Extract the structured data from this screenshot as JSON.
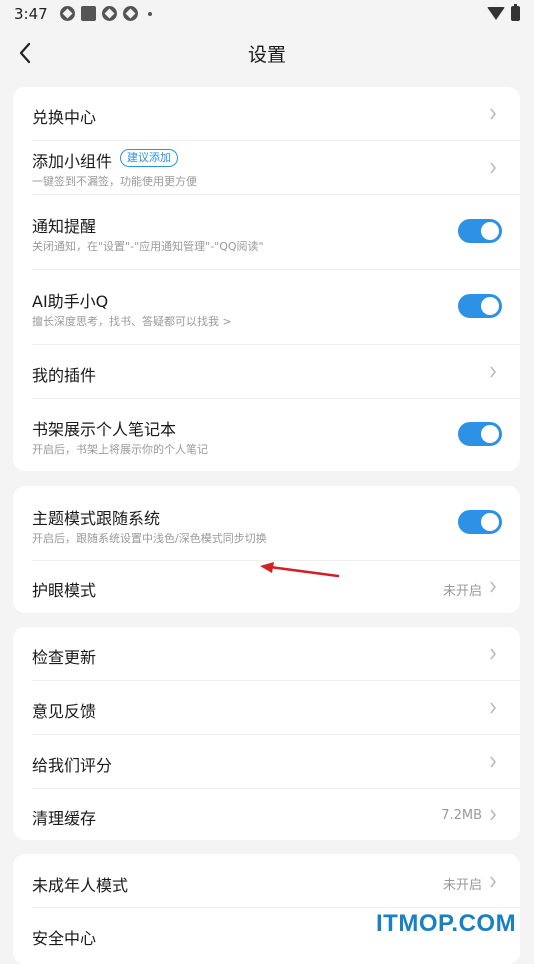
{
  "status_bar": {
    "time": "3:47"
  },
  "header": {
    "title": "设置"
  },
  "group1": {
    "redeem": {
      "label": "兑换中心"
    },
    "widget": {
      "label": "添加小组件",
      "badge": "建议添加",
      "sub": "一键签到不漏签，功能使用更方便"
    },
    "notify": {
      "label": "通知提醒",
      "sub": "关闭通知，在\"设置\"-\"应用通知管理\"-\"QQ阅读\"",
      "enabled": true
    },
    "ai": {
      "label": "AI助手小Q",
      "sub": "擅长深度思考，找书、答疑都可以找我 >",
      "enabled": true
    },
    "plugins": {
      "label": "我的插件"
    },
    "notebook": {
      "label": "书架展示个人笔记本",
      "sub": "开启后，书架上将展示你的个人笔记",
      "enabled": true
    }
  },
  "group2": {
    "theme": {
      "label": "主题模式跟随系统",
      "sub": "开启后，跟随系统设置中浅色/深色模式同步切换",
      "enabled": true
    },
    "eye": {
      "label": "护眼模式",
      "value": "未开启"
    }
  },
  "group3": {
    "update": {
      "label": "检查更新"
    },
    "feedback": {
      "label": "意见反馈"
    },
    "rate": {
      "label": "给我们评分"
    },
    "cache": {
      "label": "清理缓存",
      "value": "7.2MB"
    }
  },
  "group4": {
    "minor": {
      "label": "未成年人模式",
      "value": "未开启"
    },
    "security": {
      "label": "安全中心"
    }
  },
  "watermark": "ITMOP.COM",
  "colors": {
    "accent": "#2d91e6",
    "background": "#f4f4f4",
    "annotation_arrow": "#d32020"
  }
}
